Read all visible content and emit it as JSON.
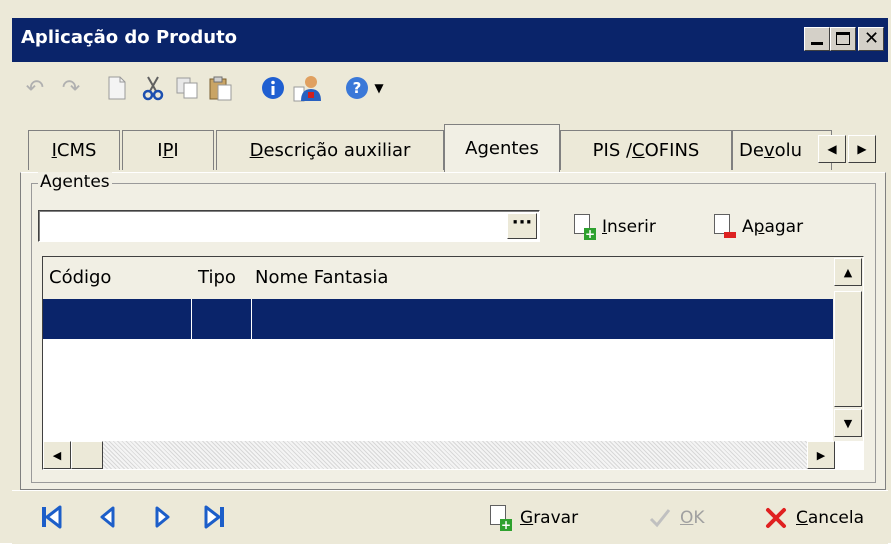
{
  "window": {
    "title": "Aplicação do Produto",
    "controls": [
      "minimize",
      "maximize",
      "close"
    ]
  },
  "toolbar": {
    "icons": [
      "undo-icon",
      "redo-icon",
      "new-document-icon",
      "cut-icon",
      "copy-icon",
      "paste-icon",
      "info-icon",
      "user-icon",
      "help-icon",
      "dropdown-arrow-icon"
    ],
    "dropdown_arrow": "▼"
  },
  "tabs": [
    {
      "label_pre": "",
      "label_u": "I",
      "label_post": "CMS"
    },
    {
      "label_pre": "I",
      "label_u": "P",
      "label_post": "I"
    },
    {
      "label_pre": "",
      "label_u": "D",
      "label_post": "escrição auxiliar"
    },
    {
      "label_pre": "Agentes",
      "label_u": "",
      "label_post": ""
    },
    {
      "label_pre": "PIS / ",
      "label_u": "C",
      "label_post": "OFINS"
    },
    {
      "label_pre": "De",
      "label_u": "v",
      "label_post": "olu"
    }
  ],
  "active_tab": "Agentes",
  "agentes": {
    "group_label": "Agentes",
    "input_value": "",
    "browse_label": "···",
    "insert_button": {
      "u": "I",
      "rest": "nserir"
    },
    "delete_button": {
      "pre": "A",
      "u": "p",
      "rest": "agar"
    },
    "grid": {
      "columns": [
        "Código",
        "Tipo",
        "Nome Fantasia"
      ],
      "rows": [
        {
          "codigo": "",
          "tipo": "",
          "nome": "",
          "selected": true
        }
      ]
    }
  },
  "bottom": {
    "nav": [
      "first-record-icon",
      "previous-record-icon",
      "next-record-icon",
      "last-record-icon"
    ],
    "save_button": {
      "u": "G",
      "rest": "ravar"
    },
    "ok_button": {
      "u": "O",
      "rest": "K",
      "disabled": true
    },
    "cancel_button": {
      "u": "C",
      "rest": "ancela"
    }
  },
  "colors": {
    "titlebar": "#0a246a",
    "selection": "#0a246a",
    "face": "#ece9d8",
    "nav_arrow": "#1c5ec9"
  }
}
